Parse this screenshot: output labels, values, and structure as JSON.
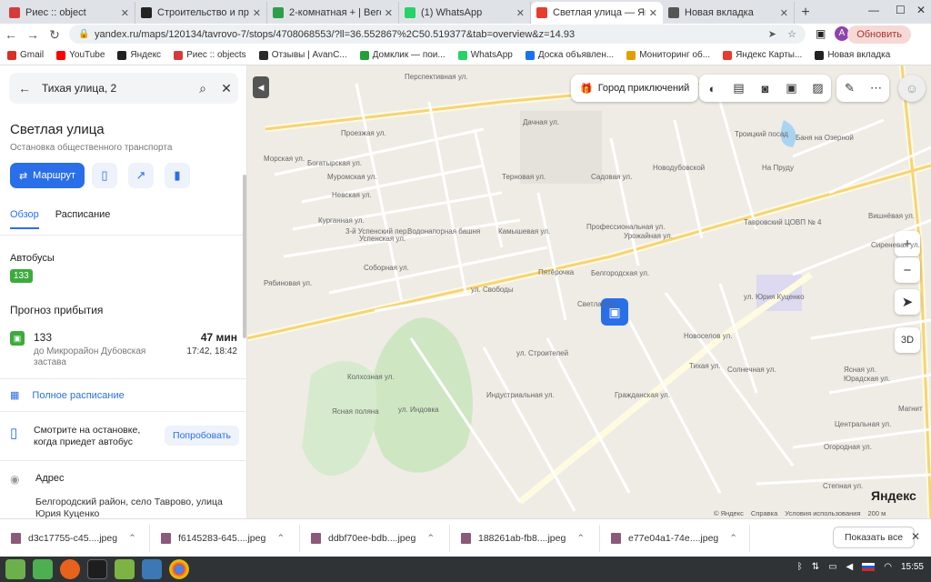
{
  "browser": {
    "tabs": [
      {
        "title": "Риес :: object",
        "color": "#d63b3b"
      },
      {
        "title": "Строительство и продажа",
        "color": "#222222"
      },
      {
        "title": "2-комнатная + | Вегол",
        "color": "#2e9e4a"
      },
      {
        "title": "(1) WhatsApp",
        "color": "#25d366"
      },
      {
        "title": "Светлая улица — Янд",
        "color": "#e63b2e"
      },
      {
        "title": "Новая вкладка",
        "color": "#555555"
      }
    ],
    "url": "yandex.ru/maps/120134/tavrovo-7/stops/4708068553/?ll=36.552867%2C50.519377&tab=overview&z=14.93",
    "update_label": "Обновить",
    "profile_letter": "A",
    "bookmarks": [
      {
        "label": "Gmail",
        "color": "#d93025"
      },
      {
        "label": "YouTube",
        "color": "#ff0000"
      },
      {
        "label": "Яндекс",
        "color": "#222222"
      },
      {
        "label": "Риес :: objects",
        "color": "#d63b3b"
      },
      {
        "label": "Отзывы | AvanC...",
        "color": "#2a2a2a"
      },
      {
        "label": "Домклик — пои...",
        "color": "#21a038"
      },
      {
        "label": "WhatsApp",
        "color": "#25d366"
      },
      {
        "label": "Доска объявлен...",
        "color": "#1a73e8"
      },
      {
        "label": "Мониторинг об...",
        "color": "#e0a100"
      },
      {
        "label": "Яндекс Карты...",
        "color": "#e63b2e"
      },
      {
        "label": "Новая вкладка",
        "color": "#222222"
      }
    ]
  },
  "panel": {
    "search_value": "Тихая улица, 2",
    "title": "Светлая улица",
    "subtitle": "Остановка общественного транспорта",
    "route_label": "Маршрут",
    "tabs": [
      "Обзор",
      "Расписание"
    ],
    "buses_heading": "Автобусы",
    "bus_number": "133",
    "forecast_heading": "Прогноз прибытия",
    "arrival": {
      "number": "133",
      "destination": "до Микрорайон Дубовская застава",
      "minutes": "47 мин",
      "times": "17:42, 18:42"
    },
    "full_schedule": "Полное расписание",
    "try_text": "Смотрите на остановке, когда приедет автобус",
    "try_button": "Попробовать",
    "address_label": "Адрес",
    "address_value": "Белгородский район, село Таврово, улица Юрия Куценко"
  },
  "map": {
    "city_label": "Город приключений",
    "logo": "Яндекс",
    "attribution": [
      "© Яндекс",
      "Справка",
      "Условия использования",
      "200 м"
    ],
    "labels": [
      "Перспективная ул.",
      "Проезжая ул.",
      "Морская ул.",
      "Богатырская ул.",
      "Муромская ул.",
      "Невская ул.",
      "Курганная ул.",
      "3-й Успенский пер.",
      "Успенская ул.",
      "Соборная ул.",
      "Рябиновая ул.",
      "Водонапорная башня",
      "Пятёрочка",
      "ул. Свободы",
      "Профессиональная ул.",
      "Урожайная ул.",
      "Белгородская ул.",
      "Тавровский ЦОВП № 4",
      "ул. Юрия Куценко",
      "ул. Строителей",
      "Индустриальная ул.",
      "Гражданская ул.",
      "ул. Индовка",
      "Ясная поляна",
      "Новодубовской",
      "Троицкий посад",
      "Баня на Озерной",
      "На Пруду",
      "Вишнёвая ул.",
      "Тихая ул.",
      "Солнечная ул.",
      "Сиреневая ул.",
      "Юрадская ул.",
      "Магнит",
      "Степная ул.",
      "Огородная ул.",
      "Ясная ул.",
      "Терновая ул.",
      "Дачная ул.",
      "Садовая ул.",
      "Камышевая ул.",
      "Новоселов ул.",
      "Светлая ул.",
      "Колхозная ул.",
      "Центральная ул."
    ]
  },
  "downloads": {
    "files": [
      "d3c17755-c45....jpeg",
      "f6145283-645....jpeg",
      "ddbf70ee-bdb....jpeg",
      "188261ab-fb8....jpeg",
      "e77e04a1-74e....jpeg"
    ],
    "show_all": "Показать все"
  },
  "taskbar": {
    "clock": "15:55"
  }
}
